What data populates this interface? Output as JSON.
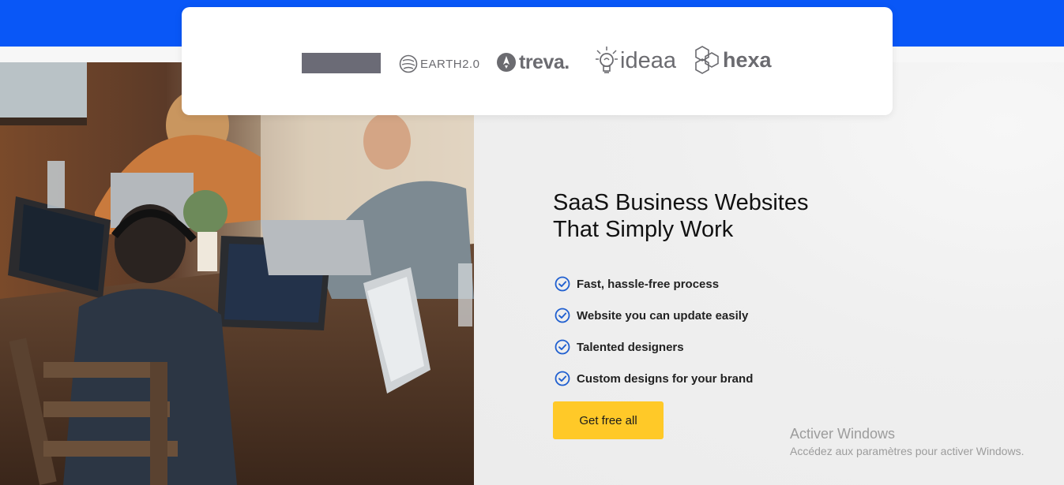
{
  "logos": {
    "earth": "EARTH2.0",
    "treva": "treva.",
    "ideaa": "ideaa",
    "hexa": "hexa"
  },
  "hero": {
    "title_line1": "SaaS Business Websites",
    "title_line2": "That Simply Work",
    "features": [
      "Fast, hassle-free process",
      "Website you can update easily",
      "Talented designers",
      "Custom designs for your brand"
    ],
    "cta_label": "Get free all"
  },
  "watermark": {
    "title": "Activer Windows",
    "subtitle": "Accédez aux paramètres pour activer Windows."
  },
  "colors": {
    "brand_blue": "#0957f7",
    "check_blue": "#1f5fd0",
    "cta_yellow": "#ffc928"
  },
  "icons": [
    "earth-icon",
    "rocket-icon",
    "lightbulb-icon",
    "hexagon-icon",
    "check-circle-icon"
  ]
}
